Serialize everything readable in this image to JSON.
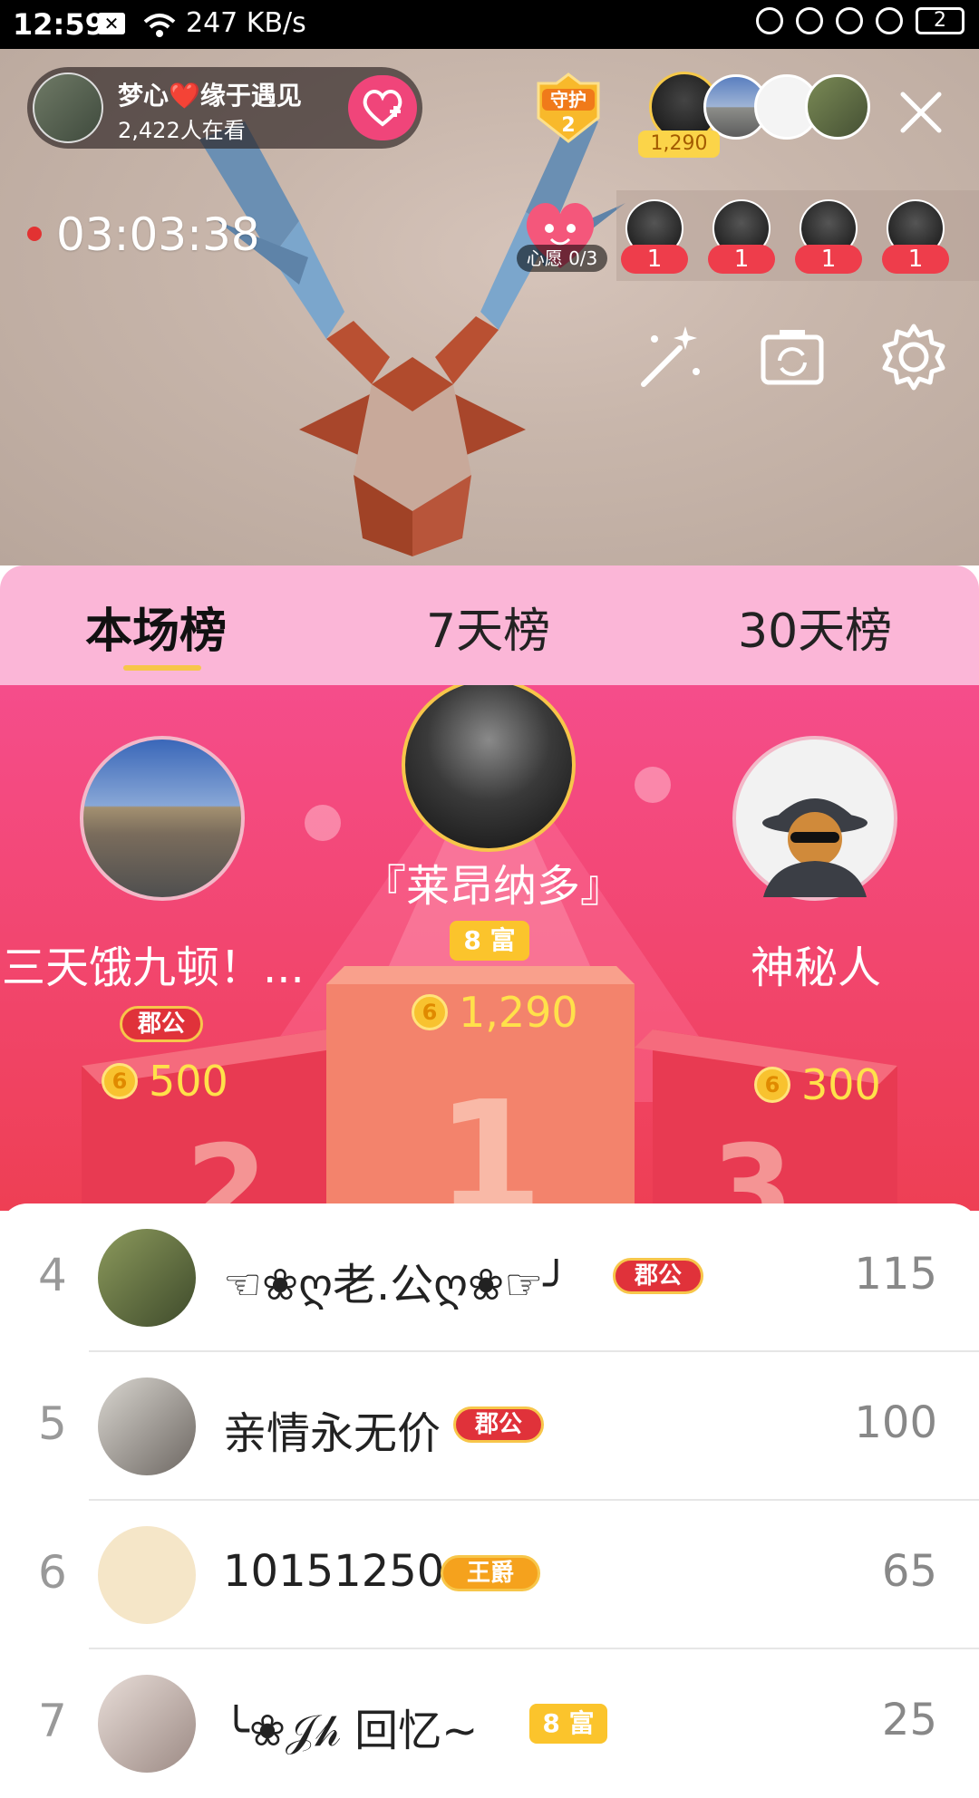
{
  "status_bar": {
    "time": "12:59",
    "network_speed": "247 KB/s",
    "battery": "2"
  },
  "live": {
    "host_name": "梦心❤️缘于遇见",
    "viewers": "2,422人在看",
    "guard_label": "守护",
    "guard_count": "2",
    "top_viewer_coins": "1,290",
    "elapsed": "03:03:38",
    "wish_label": "心愿 0/3",
    "mic_counts": [
      "1",
      "1",
      "1",
      "1"
    ]
  },
  "tabs": [
    "本场榜",
    "7天榜",
    "30天榜"
  ],
  "podium": {
    "first": {
      "name": "『莱昂纳多』",
      "badge": "8 富",
      "coins": "1,290"
    },
    "second": {
      "name": "三天饿九顿！...",
      "badge": "郡公",
      "coins": "500"
    },
    "third": {
      "name": "神秘人",
      "coins": "300"
    }
  },
  "ranking": [
    {
      "rank": "4",
      "name": "☜❀ღ老.公ღ❀☞╯",
      "badge": "郡公",
      "score": "115"
    },
    {
      "rank": "5",
      "name": "亲情永无价",
      "badge": "郡公",
      "score": "100"
    },
    {
      "rank": "6",
      "name": "10151250",
      "badge": "王爵",
      "score": "65"
    },
    {
      "rank": "7",
      "name": "╰❀𝒥𝒽 回忆~",
      "badge": "8 富",
      "score": "25"
    }
  ],
  "coin_glyph": "6",
  "colors": {
    "tabs_bg": "#fbb6d7",
    "podium_bg": "#f2466f",
    "coin": "#ffe14a",
    "badge_red": "#e0323a",
    "badge_gold": "#fbc42c"
  }
}
